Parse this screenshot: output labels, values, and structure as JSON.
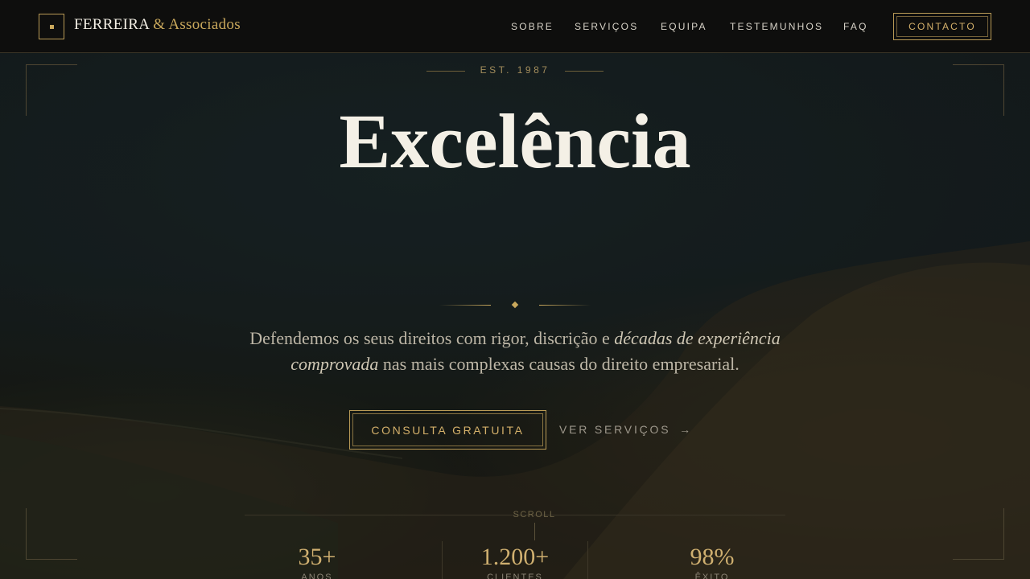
{
  "header": {
    "brand_name": "FERREIRA",
    "brand_suffix": "& Associados",
    "nav": [
      "SOBRE",
      "SERVIÇOS",
      "EQUIPA",
      "TESTEMUNHOS",
      "FAQ"
    ],
    "contact_label": "CONTACTO"
  },
  "hero": {
    "established": "EST. 1987",
    "headline": "Excelência",
    "description_part1": "Defendemos os seus direitos com rigor, discrição e ",
    "description_em": "décadas de experiência comprovada",
    "description_part2": " nas mais complexas causas do direito empresarial.",
    "cta_primary": "CONSULTA GRATUITA",
    "cta_secondary": "VER SERVIÇOS",
    "cta_secondary_arrow": "→",
    "scroll_label": "SCROLL"
  },
  "stats": [
    {
      "value": "35+",
      "label": "ANOS"
    },
    {
      "value": "1.200+",
      "label": "CLIENTES"
    },
    {
      "value": "98%",
      "label": "ÊXITO"
    }
  ],
  "colors": {
    "accent_gold": "#c9a85c",
    "header_bg": "#0e0e0d",
    "text_light": "#f4f0e6"
  }
}
